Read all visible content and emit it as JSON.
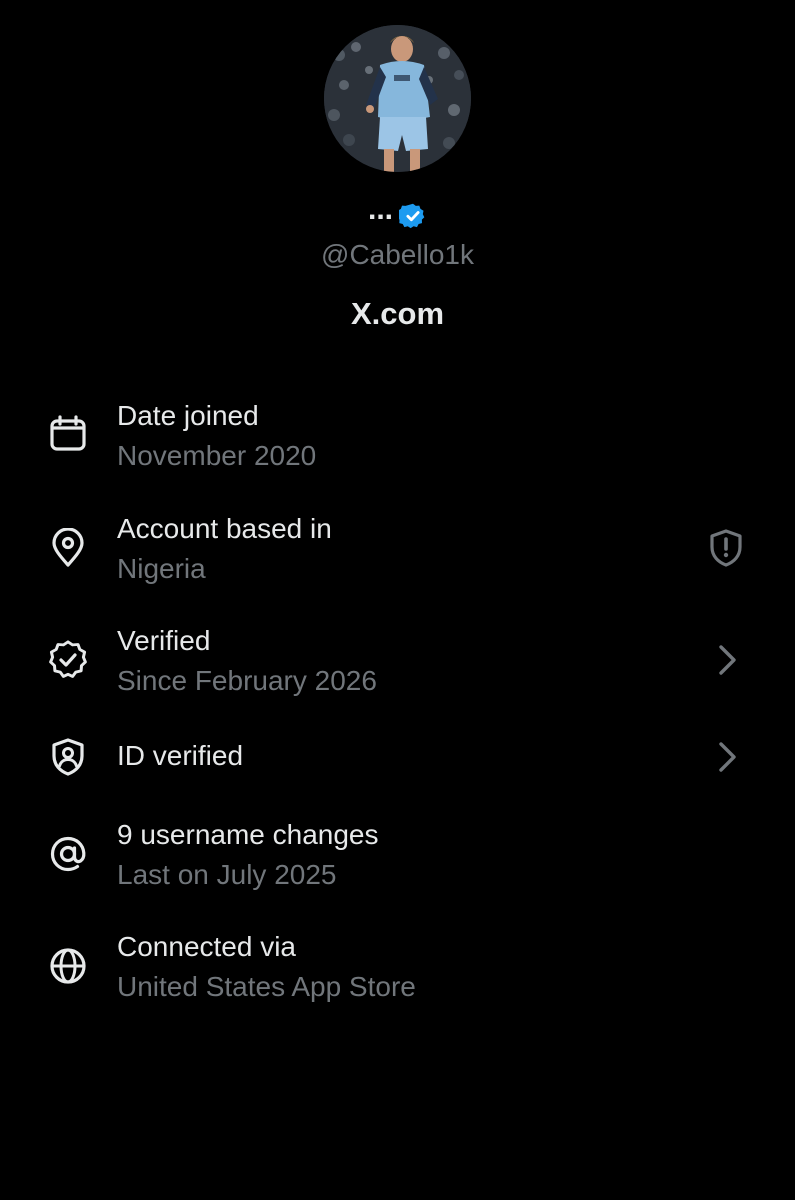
{
  "profile": {
    "display_name": "...",
    "handle": "@Cabello1k",
    "site": "X.com"
  },
  "colors": {
    "background": "#000000",
    "primary_text": "#e7e9ea",
    "secondary_text": "#71767b",
    "verified_blue": "#1d9bf0"
  },
  "info": {
    "date_joined": {
      "icon": "calendar-icon",
      "title": "Date joined",
      "value": "November 2020"
    },
    "account_based": {
      "icon": "location-pin-icon",
      "title": "Account based in",
      "value": "Nigeria",
      "trailing_icon": "shield-alert-icon"
    },
    "verified": {
      "icon": "verified-badge-outline-icon",
      "title": "Verified",
      "value": "Since February 2026",
      "trailing_icon": "chevron-right-icon"
    },
    "id_verified": {
      "icon": "id-shield-icon",
      "title": "ID verified",
      "trailing_icon": "chevron-right-icon"
    },
    "username_changes": {
      "icon": "at-sign-icon",
      "title": "9 username changes",
      "value": "Last on July 2025"
    },
    "connected_via": {
      "icon": "globe-icon",
      "title": "Connected via",
      "value": "United States App Store"
    }
  }
}
